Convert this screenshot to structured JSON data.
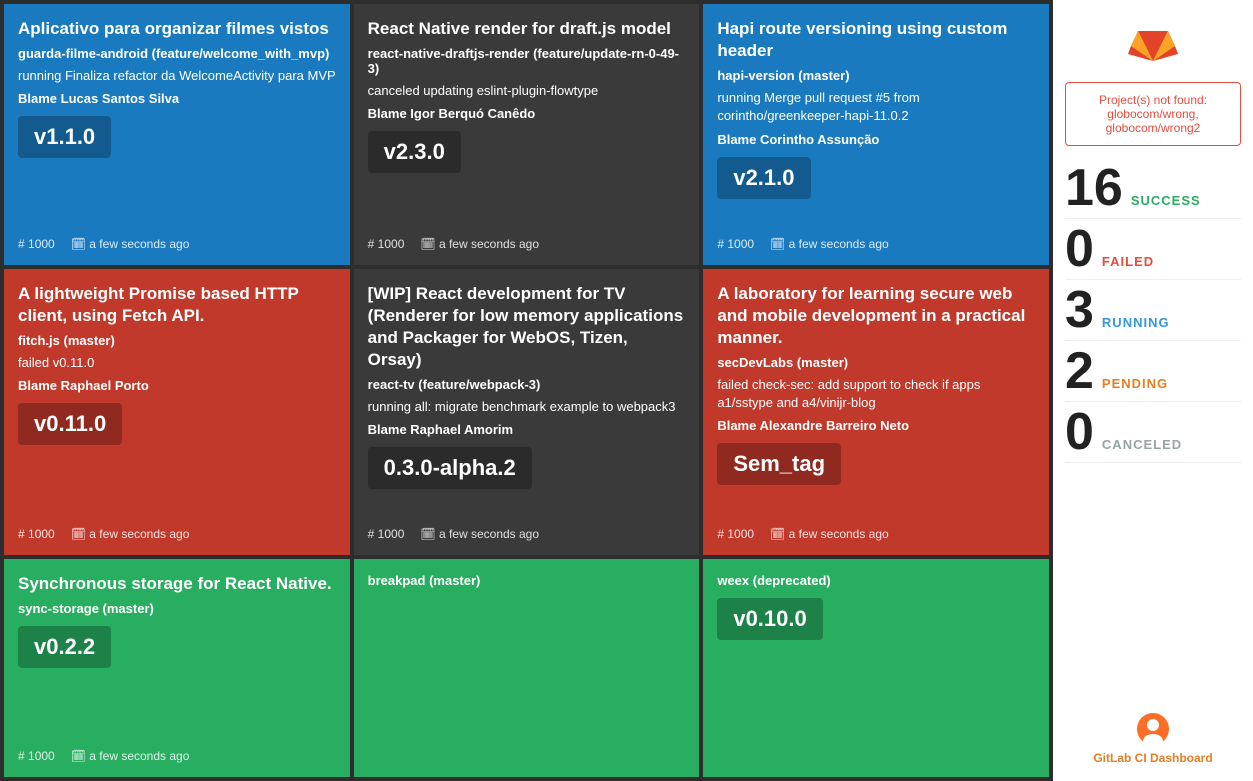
{
  "cards": [
    {
      "id": "card-1",
      "status": "blue",
      "title": "Aplicativo para organizar filmes vistos",
      "repo": "guarda-filme-android (feature/welcome_with_mvp)",
      "desc": "running Finaliza refactor da WelcomeActivity para MVP",
      "blame": "Blame Lucas Santos Silva",
      "version": "v1.1.0",
      "build": "1000",
      "timestamp": "a few seconds ago"
    },
    {
      "id": "card-2",
      "status": "dark",
      "title": "React Native render for draft.js model",
      "repo": "react-native-draftjs-render (feature/update-rn-0-49-3)",
      "desc": "canceled updating eslint-plugin-flowtype",
      "blame": "Blame Igor Berquó Canêdo",
      "version": "v2.3.0",
      "build": "1000",
      "timestamp": "a few seconds ago"
    },
    {
      "id": "card-3",
      "status": "blue",
      "title": "Hapi route versioning using custom header",
      "repo": "hapi-version (master)",
      "desc": "running Merge pull request #5 from corintho/greenkeeper-hapi-11.0.2",
      "blame": "Blame Corintho Assunção",
      "version": "v2.1.0",
      "build": "1000",
      "timestamp": "a few seconds ago"
    },
    {
      "id": "card-4",
      "status": "red",
      "title": "A lightweight Promise based HTTP client, using Fetch API.",
      "repo": "fitch.js (master)",
      "desc": "failed v0.11.0",
      "blame": "Blame Raphael Porto",
      "version": "v0.11.0",
      "build": "1000",
      "timestamp": "a few seconds ago"
    },
    {
      "id": "card-5",
      "status": "dark",
      "title": "[WIP] React development for TV (Renderer for low memory applications and Packager for WebOS, Tizen, Orsay)",
      "repo": "react-tv (feature/webpack-3)",
      "desc": "running all: migrate benchmark example to webpack3",
      "blame": "Blame Raphael Amorim",
      "version": "0.3.0-alpha.2",
      "build": "1000",
      "timestamp": "a few seconds ago"
    },
    {
      "id": "card-6",
      "status": "red",
      "title": "A laboratory for learning secure web and mobile development in a practical manner.",
      "repo": "secDevLabs (master)",
      "desc": "failed check-sec: add support to check if apps a1/sstype and a4/vinijr-blog",
      "blame": "Blame Alexandre Barreiro Neto",
      "version": "Sem_tag",
      "build": "1000",
      "timestamp": "a few seconds ago"
    },
    {
      "id": "card-7",
      "status": "green",
      "title": "Synchronous storage for React Native.",
      "repo": "sync-storage (master)",
      "desc": "",
      "blame": "",
      "version": "v0.2.2",
      "build": "1000",
      "timestamp": "a few seconds ago"
    },
    {
      "id": "card-8",
      "status": "green",
      "title": "",
      "repo": "breakpad (master)",
      "desc": "",
      "blame": "",
      "version": "",
      "build": "",
      "timestamp": ""
    },
    {
      "id": "card-9",
      "status": "green",
      "title": "",
      "repo": "weex (deprecated)",
      "desc": "",
      "blame": "",
      "version": "v0.10.0",
      "build": "",
      "timestamp": ""
    }
  ],
  "sidebar": {
    "error": {
      "text": "Project(s) not found: globocom/wrong, globocom/wrong2"
    },
    "stats": [
      {
        "number": "16",
        "label": "SUCCESS",
        "class": "success"
      },
      {
        "number": "0",
        "label": "FAILED",
        "class": "failed"
      },
      {
        "number": "3",
        "label": "RUNNING",
        "class": "running"
      },
      {
        "number": "2",
        "label": "PENDING",
        "class": "pending"
      },
      {
        "number": "0",
        "label": "CANCELED",
        "class": "canceled"
      }
    ],
    "footer_text": "GitLab CI Dashboard"
  }
}
